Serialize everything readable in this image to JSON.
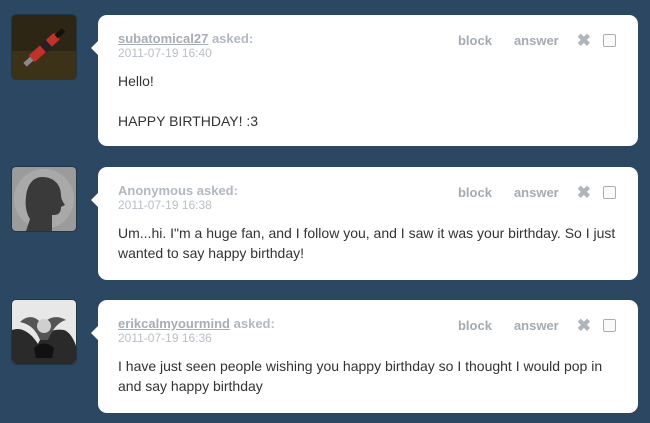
{
  "labels": {
    "block": "block",
    "answer": "answer",
    "asked": "asked:",
    "close_glyph": "✖"
  },
  "messages": [
    {
      "sender": "subatomical27",
      "date": "2011-07-19 16:40",
      "paragraphs": [
        "Hello!",
        "HAPPY BIRTHDAY! :3"
      ]
    },
    {
      "sender": "Anonymous",
      "date": "2011-07-19 16:38",
      "paragraphs": [
        "Um...hi. I\"m a huge fan, and I follow you, and I saw it was your birthday. So I just wanted to say happy birthday!"
      ]
    },
    {
      "sender": "erikcalmyourmind",
      "date": "2011-07-19 16:36",
      "paragraphs": [
        "I have just seen people wishing you happy birthday so I thought I would pop in and say happy birthday"
      ]
    }
  ],
  "colors": {
    "background": "#2c4762",
    "bubble": "#ffffff",
    "meta_text": "#b2b8c0",
    "body_text": "#333333"
  }
}
